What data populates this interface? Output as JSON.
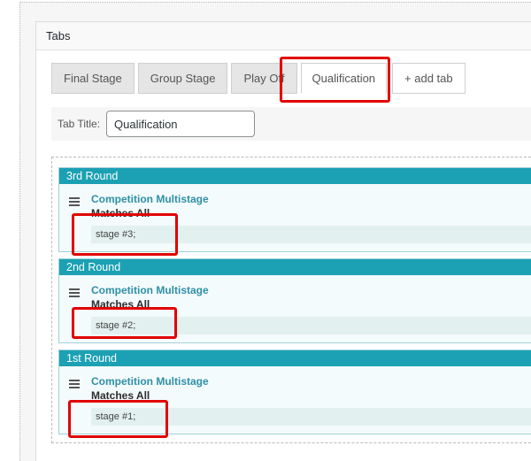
{
  "panel": {
    "title": "Tabs"
  },
  "tabs": [
    {
      "label": "Final Stage"
    },
    {
      "label": "Group Stage"
    },
    {
      "label": "Play Off"
    },
    {
      "label": "Qualification"
    },
    {
      "label": "+ add tab"
    }
  ],
  "tab_title": {
    "label": "Tab Title:",
    "value": "Qualification"
  },
  "rounds": [
    {
      "title": "3rd Round",
      "competition": "Competition Multistage",
      "matches": "Matches All",
      "stage": "stage #3;"
    },
    {
      "title": "2nd Round",
      "competition": "Competition Multistage",
      "matches": "Matches All",
      "stage": "stage #2;"
    },
    {
      "title": "1st Round",
      "competition": "Competition Multistage",
      "matches": "Matches All",
      "stage": "stage #1;"
    }
  ],
  "colors": {
    "round_header": "#1ba1b3",
    "competition_link": "#2e8fa6",
    "highlight": "#e10000"
  }
}
